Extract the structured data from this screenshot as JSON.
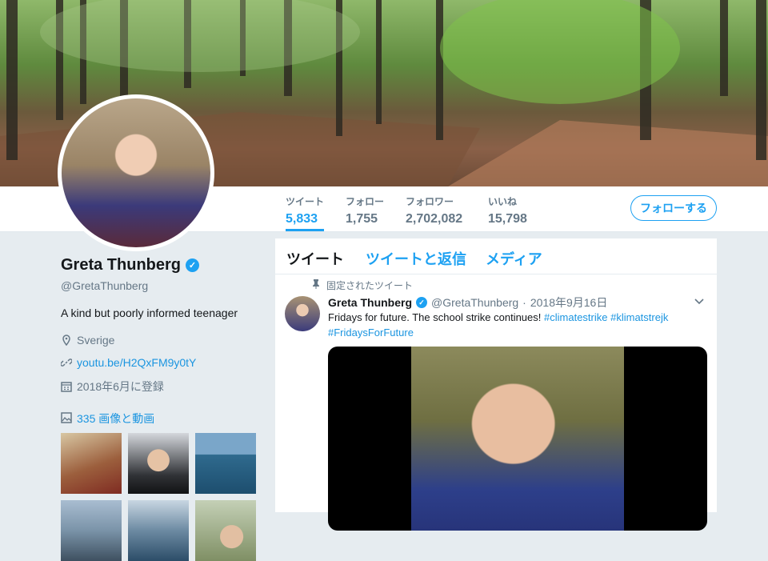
{
  "nav": {
    "stats": [
      {
        "label": "ツイート",
        "value": "5,833"
      },
      {
        "label": "フォロー",
        "value": "1,755"
      },
      {
        "label": "フォロワー",
        "value": "2,702,082"
      },
      {
        "label": "いいね",
        "value": "15,798"
      }
    ],
    "follow_label": "フォローする"
  },
  "profile": {
    "name": "Greta Thunberg",
    "handle": "@GretaThunberg",
    "bio": "A kind but poorly informed teenager",
    "location": "Sverige",
    "url": "youtu.be/H2QxFM9y0tY",
    "joined": "2018年6月に登録",
    "media_label": "335 画像と動画"
  },
  "timeline": {
    "tabs": [
      "ツイート",
      "ツイートと返信",
      "メディア"
    ],
    "pinned_label": "固定されたツイート",
    "tweet": {
      "name": "Greta Thunberg",
      "handle": "@GretaThunberg",
      "separator": "·",
      "date": "2018年9月16日",
      "text": "Fridays for future. The school strike continues!",
      "hashtags": [
        "#climatestrike",
        "#klimatstrejk",
        "#FridaysForFuture"
      ]
    }
  },
  "colors": {
    "accent": "#1da1f2",
    "muted": "#657786",
    "background": "#e6ecf0"
  },
  "icons": [
    "verified-badge-icon",
    "location-pin-icon",
    "link-icon",
    "calendar-icon",
    "media-gallery-icon",
    "pin-icon",
    "chevron-down-icon"
  ]
}
